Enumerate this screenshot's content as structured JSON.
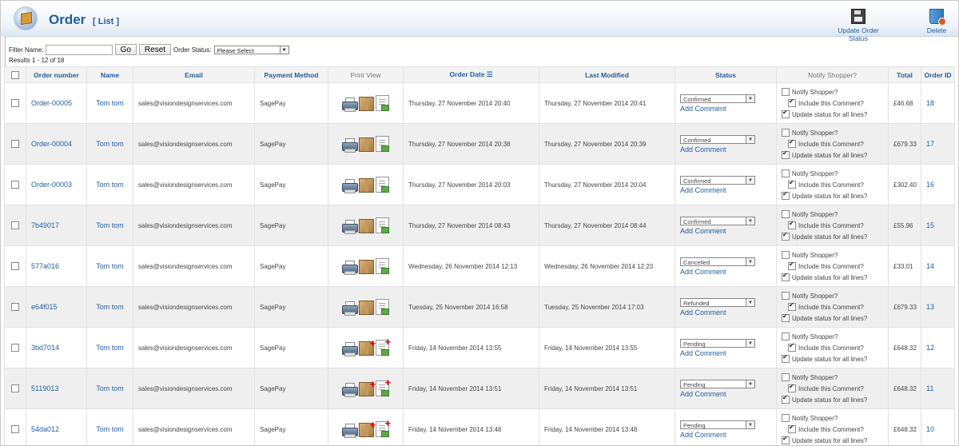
{
  "header": {
    "title": "Order",
    "subtitle": "[ List ]",
    "update_label": "Update Order Status",
    "delete_label": "Delete"
  },
  "filter": {
    "name_label": "Filter Name:",
    "name_value": "",
    "go_label": "Go",
    "reset_label": "Reset",
    "status_label": "Order Status:",
    "status_value": "Please Select"
  },
  "results_text": "Results 1 - 12 of 18",
  "table": {
    "headers": {
      "order_number": "Order number",
      "name": "Name",
      "email": "Email",
      "payment": "Payment Method",
      "print_view": "Print View",
      "order_date": "Order Date",
      "last_modified": "Last Modified",
      "status": "Status",
      "notify": "Notify Shopper?",
      "total": "Total",
      "order_id": "Order ID"
    },
    "add_comment_label": "Add Comment",
    "notify_label": "Notify Shopper?",
    "include_label": "Include this Comment?",
    "update_all_label": "Update status for all lines?",
    "rows": [
      {
        "order_number": "Order-00005",
        "name": "Tom tom",
        "email": "sales@visiondesignservices.com",
        "payment": "SagePay",
        "order_date": "Thursday, 27 November 2014 20:40",
        "last_modified": "Thursday, 27 November 2014 20:41",
        "status": "Confirmed",
        "total": "£46.68",
        "order_id": "18",
        "pending": false
      },
      {
        "order_number": "Order-00004",
        "name": "Tom tom",
        "email": "sales@visiondesignservices.com",
        "payment": "SagePay",
        "order_date": "Thursday, 27 November 2014 20:38",
        "last_modified": "Thursday, 27 November 2014 20:39",
        "status": "Confirmed",
        "total": "£679.33",
        "order_id": "17",
        "pending": false
      },
      {
        "order_number": "Order-00003",
        "name": "Tom tom",
        "email": "sales@visiondesignservices.com",
        "payment": "SagePay",
        "order_date": "Thursday, 27 November 2014 20:03",
        "last_modified": "Thursday, 27 November 2014 20:04",
        "status": "Confirmed",
        "total": "£302.40",
        "order_id": "16",
        "pending": false
      },
      {
        "order_number": "7b49017",
        "name": "Tom tom",
        "email": "sales@visiondesignservices.com",
        "payment": "SagePay",
        "order_date": "Thursday, 27 November 2014 08:43",
        "last_modified": "Thursday, 27 November 2014 08:44",
        "status": "Confirmed",
        "total": "£55.96",
        "order_id": "15",
        "pending": false
      },
      {
        "order_number": "577a016",
        "name": "Tom tom",
        "email": "sales@visiondesignservices.com",
        "payment": "SagePay",
        "order_date": "Wednesday, 26 November 2014 12:13",
        "last_modified": "Wednesday, 26 November 2014 12:23",
        "status": "Cancelled",
        "total": "£33.01",
        "order_id": "14",
        "pending": false
      },
      {
        "order_number": "e64f015",
        "name": "Tom tom",
        "email": "sales@visiondesignservices.com",
        "payment": "SagePay",
        "order_date": "Tuesday, 25 November 2014 16:58",
        "last_modified": "Tuesday, 25 November 2014 17:03",
        "status": "Refunded",
        "total": "£679.33",
        "order_id": "13",
        "pending": false
      },
      {
        "order_number": "3bd7014",
        "name": "Tom tom",
        "email": "sales@visiondesignservices.com",
        "payment": "SagePay",
        "order_date": "Friday, 14 November 2014 13:55",
        "last_modified": "Friday, 14 November 2014 13:55",
        "status": "Pending",
        "total": "£648.32",
        "order_id": "12",
        "pending": true
      },
      {
        "order_number": "5119013",
        "name": "Tom tom",
        "email": "sales@visiondesignservices.com",
        "payment": "SagePay",
        "order_date": "Friday, 14 November 2014 13:51",
        "last_modified": "Friday, 14 November 2014 13:51",
        "status": "Pending",
        "total": "£648.32",
        "order_id": "11",
        "pending": true
      },
      {
        "order_number": "54da012",
        "name": "Tom tom",
        "email": "sales@visiondesignservices.com",
        "payment": "SagePay",
        "order_date": "Friday, 14 November 2014 13:48",
        "last_modified": "Friday, 14 November 2014 13:48",
        "status": "Pending",
        "total": "£648.32",
        "order_id": "10",
        "pending": true
      }
    ]
  }
}
